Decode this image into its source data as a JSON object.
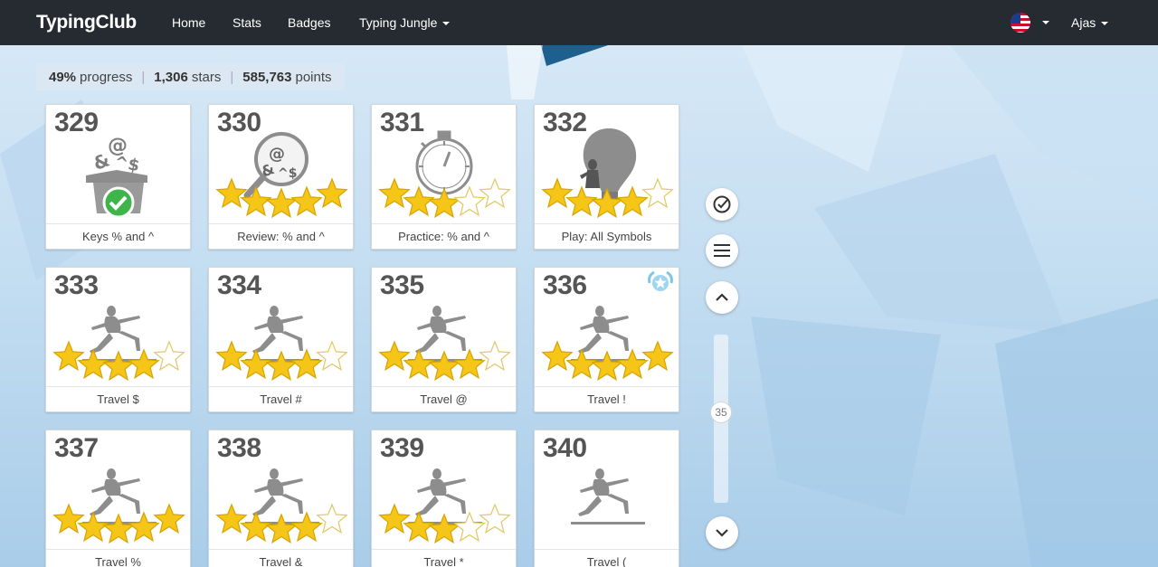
{
  "nav": {
    "logo": "TypingClub",
    "items": [
      "Home",
      "Stats",
      "Badges",
      "Typing Jungle"
    ],
    "user": "Ajas"
  },
  "progress": {
    "percent": "49%",
    "percent_label": "progress",
    "stars": "1,306",
    "stars_label": "stars",
    "points": "585,763",
    "points_label": "points"
  },
  "lessons": [
    {
      "num": "329",
      "name": "Keys % and ^",
      "art": "box",
      "stars": null,
      "done": true
    },
    {
      "num": "330",
      "name": "Review: % and ^",
      "art": "magnifier",
      "stars": 5
    },
    {
      "num": "331",
      "name": "Practice: % and ^",
      "art": "stopwatch",
      "stars": 3
    },
    {
      "num": "332",
      "name": "Play: All Symbols",
      "art": "balloon",
      "stars": 4
    },
    {
      "num": "333",
      "name": "Travel $",
      "art": "runner",
      "stars": 4
    },
    {
      "num": "334",
      "name": "Travel #",
      "art": "runner",
      "stars": 4
    },
    {
      "num": "335",
      "name": "Travel @",
      "art": "runner",
      "stars": 4
    },
    {
      "num": "336",
      "name": "Travel !",
      "art": "runner",
      "stars": 5,
      "badge": true
    },
    {
      "num": "337",
      "name": "Travel %",
      "art": "runner",
      "stars": 5
    },
    {
      "num": "338",
      "name": "Travel &",
      "art": "runner",
      "stars": 4
    },
    {
      "num": "339",
      "name": "Travel *",
      "art": "runner",
      "stars": 3
    },
    {
      "num": "340",
      "name": "Travel (",
      "art": "runner",
      "stars": 0
    }
  ],
  "scroll": {
    "value": "35"
  },
  "colors": {
    "nav_bg": "#262b31",
    "star_fill": "#f5c518",
    "star_empty": "#ffffff",
    "check_green": "#3eb54a"
  }
}
